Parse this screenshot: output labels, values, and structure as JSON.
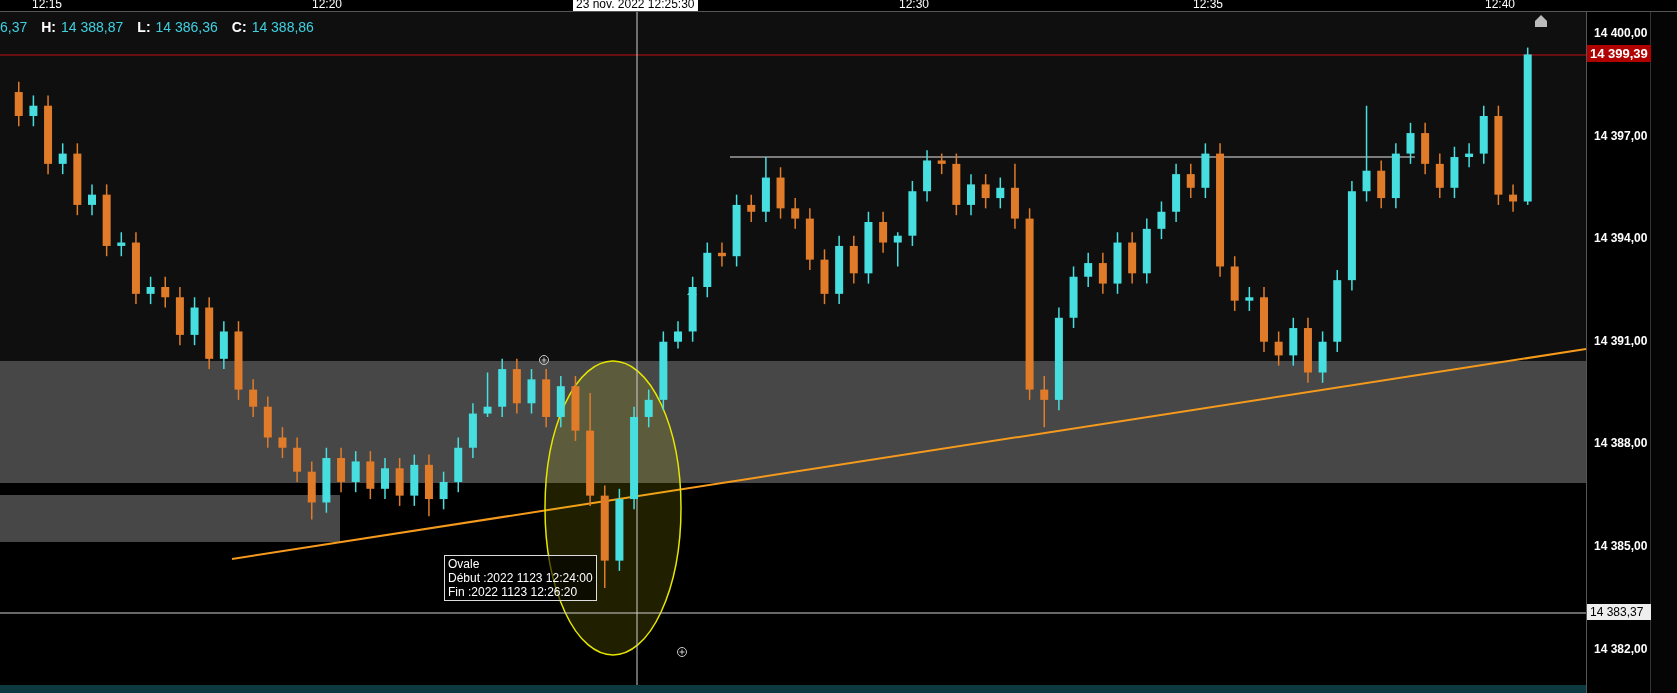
{
  "time_axis": {
    "labels": [
      "12:15",
      "12:20",
      "12:30",
      "12:35",
      "12:40"
    ],
    "crosshair_label": "23 nov. 2022 12:25:30"
  },
  "legend": {
    "partial_value": "6,37",
    "items": [
      {
        "label": "H:",
        "value": "14 388,87"
      },
      {
        "label": "L:",
        "value": "14 386,36"
      },
      {
        "label": "C:",
        "value": "14 388,86"
      }
    ]
  },
  "price_axis": {
    "last_price_label": "14 399,39",
    "crosshair_label": "14 383,37"
  },
  "tooltip": {
    "title": "Ovale",
    "lines": [
      "Début :2022 1123 12:24:00",
      "Fin :2022 1123 12:26:20"
    ]
  },
  "chart_data": {
    "type": "candlestick",
    "ylim": [
      14380.73,
      14400.64
    ],
    "yticks": [
      {
        "value": 14400,
        "label": "14 400,00"
      },
      {
        "value": 14397,
        "label": "14 397,00"
      },
      {
        "value": 14394,
        "label": "14 394,00"
      },
      {
        "value": 14391,
        "label": "14 391,00"
      },
      {
        "value": 14388,
        "label": "14 388,00"
      },
      {
        "value": 14385,
        "label": "14 385,00"
      },
      {
        "value": 14382,
        "label": "14 382,00"
      }
    ],
    "categories": [
      null,
      null,
      null,
      null,
      null,
      null,
      null,
      null,
      null,
      null,
      null,
      null,
      null,
      null,
      null,
      null,
      null,
      null,
      null,
      null,
      null,
      null,
      null,
      null,
      null,
      null,
      null,
      null,
      null,
      null,
      null,
      null,
      null,
      null,
      null,
      null,
      null,
      null,
      null,
      null,
      null,
      null,
      null,
      null,
      null,
      null,
      null,
      null,
      null,
      null,
      null,
      null,
      null,
      null,
      null,
      null,
      null,
      null,
      null,
      null,
      null,
      null,
      null,
      null,
      null,
      null,
      null,
      null,
      null,
      null,
      null,
      null,
      null,
      null,
      null,
      null,
      null,
      null,
      null,
      null,
      null,
      null,
      null,
      null,
      null,
      null,
      null,
      null,
      null,
      null,
      null,
      null,
      null,
      null,
      null,
      null,
      null,
      null,
      null,
      null,
      null,
      null,
      null,
      null
    ],
    "ohlc": [
      [
        14398.3,
        14398.6,
        14397.3,
        14397.6
      ],
      [
        14397.6,
        14398.2,
        14397.3,
        14397.9
      ],
      [
        14397.9,
        14398.2,
        14395.9,
        14396.2
      ],
      [
        14396.2,
        14396.8,
        14395.9,
        14396.5
      ],
      [
        14396.5,
        14396.8,
        14394.7,
        14395.0
      ],
      [
        14395.0,
        14395.6,
        14394.7,
        14395.3
      ],
      [
        14395.3,
        14395.6,
        14393.5,
        14393.8
      ],
      [
        14393.8,
        14394.2,
        14393.5,
        14393.9
      ],
      [
        14393.9,
        14394.2,
        14392.1,
        14392.4
      ],
      [
        14392.4,
        14392.9,
        14392.1,
        14392.6
      ],
      [
        14392.6,
        14392.9,
        14392.0,
        14392.3
      ],
      [
        14392.3,
        14392.6,
        14390.9,
        14391.2
      ],
      [
        14391.2,
        14392.3,
        14390.9,
        14392.0
      ],
      [
        14392.0,
        14392.3,
        14390.2,
        14390.5
      ],
      [
        14390.5,
        14391.6,
        14390.2,
        14391.3
      ],
      [
        14391.3,
        14391.6,
        14389.3,
        14389.6
      ],
      [
        14389.6,
        14389.9,
        14388.8,
        14389.1
      ],
      [
        14389.1,
        14389.4,
        14387.9,
        14388.2
      ],
      [
        14388.2,
        14388.5,
        14387.6,
        14387.9
      ],
      [
        14387.9,
        14388.2,
        14386.9,
        14387.2
      ],
      [
        14387.2,
        14387.5,
        14385.8,
        14386.3
      ],
      [
        14386.3,
        14387.9,
        14386.0,
        14387.6
      ],
      [
        14387.6,
        14387.9,
        14386.6,
        14386.9
      ],
      [
        14386.9,
        14387.8,
        14386.6,
        14387.5
      ],
      [
        14387.5,
        14387.8,
        14386.4,
        14386.7
      ],
      [
        14386.7,
        14387.6,
        14386.4,
        14387.3
      ],
      [
        14387.3,
        14387.6,
        14386.2,
        14386.5
      ],
      [
        14386.5,
        14387.7,
        14386.2,
        14387.4
      ],
      [
        14387.4,
        14387.7,
        14385.9,
        14386.4
      ],
      [
        14386.4,
        14387.2,
        14386.1,
        14386.9
      ],
      [
        14386.9,
        14388.2,
        14386.6,
        14387.9
      ],
      [
        14387.9,
        14389.2,
        14387.6,
        14388.9
      ],
      [
        14388.9,
        14390.1,
        14388.8,
        14389.1
      ],
      [
        14389.1,
        14390.5,
        14388.8,
        14390.2
      ],
      [
        14390.2,
        14390.5,
        14388.9,
        14389.2
      ],
      [
        14389.2,
        14390.2,
        14388.9,
        14389.9
      ],
      [
        14389.9,
        14390.2,
        14388.5,
        14388.8
      ],
      [
        14388.8,
        14390.0,
        14388.5,
        14389.7
      ],
      [
        14389.7,
        14390.0,
        14388.1,
        14388.4
      ],
      [
        14388.4,
        14389.5,
        14386.2,
        14386.5
      ],
      [
        14386.5,
        14386.8,
        14383.8,
        14384.6
      ],
      [
        14384.6,
        14386.7,
        14384.3,
        14386.4
      ],
      [
        14386.4,
        14389.1,
        14386.1,
        14388.8
      ],
      [
        14388.8,
        14389.6,
        14388.5,
        14389.3
      ],
      [
        14389.3,
        14391.3,
        14389.0,
        14391.0
      ],
      [
        14391.0,
        14391.6,
        14390.8,
        14391.3
      ],
      [
        14391.3,
        14392.9,
        14391.0,
        14392.6
      ],
      [
        14392.6,
        14393.9,
        14392.3,
        14393.6
      ],
      [
        14393.6,
        14393.9,
        14393.2,
        14393.5
      ],
      [
        14393.5,
        14395.3,
        14393.2,
        14395.0
      ],
      [
        14395.0,
        14395.3,
        14394.5,
        14394.8
      ],
      [
        14394.8,
        14396.4,
        14394.5,
        14395.8
      ],
      [
        14395.8,
        14396.1,
        14394.6,
        14394.9
      ],
      [
        14394.9,
        14395.2,
        14394.3,
        14394.6
      ],
      [
        14394.6,
        14394.9,
        14393.1,
        14393.4
      ],
      [
        14393.4,
        14393.7,
        14392.1,
        14392.4
      ],
      [
        14392.4,
        14394.1,
        14392.1,
        14393.8
      ],
      [
        14393.8,
        14394.1,
        14392.7,
        14393.0
      ],
      [
        14393.0,
        14394.8,
        14392.7,
        14394.5
      ],
      [
        14394.5,
        14394.8,
        14393.6,
        14393.9
      ],
      [
        14393.9,
        14394.2,
        14393.2,
        14394.1
      ],
      [
        14394.1,
        14395.7,
        14393.8,
        14395.4
      ],
      [
        14395.4,
        14396.6,
        14395.1,
        14396.3
      ],
      [
        14396.3,
        14396.5,
        14395.9,
        14396.2
      ],
      [
        14396.2,
        14396.5,
        14394.7,
        14395.0
      ],
      [
        14395.0,
        14395.9,
        14394.7,
        14395.6
      ],
      [
        14395.6,
        14395.9,
        14394.9,
        14395.2
      ],
      [
        14395.2,
        14395.8,
        14394.9,
        14395.5
      ],
      [
        14395.5,
        14396.2,
        14394.3,
        14394.6
      ],
      [
        14394.6,
        14394.9,
        14389.3,
        14389.6
      ],
      [
        14389.6,
        14390.0,
        14388.5,
        14389.3
      ],
      [
        14389.3,
        14392.0,
        14389.0,
        14391.7
      ],
      [
        14391.7,
        14393.2,
        14391.4,
        14392.9
      ],
      [
        14392.9,
        14393.6,
        14392.6,
        14393.3
      ],
      [
        14393.3,
        14393.6,
        14392.4,
        14392.7
      ],
      [
        14392.7,
        14394.2,
        14392.4,
        14393.9
      ],
      [
        14393.9,
        14394.2,
        14392.7,
        14393.0
      ],
      [
        14393.0,
        14394.6,
        14392.7,
        14394.3
      ],
      [
        14394.3,
        14395.1,
        14394.0,
        14394.8
      ],
      [
        14394.8,
        14396.2,
        14394.5,
        14395.9
      ],
      [
        14395.9,
        14396.2,
        14395.2,
        14395.5
      ],
      [
        14395.5,
        14396.8,
        14395.2,
        14396.5
      ],
      [
        14396.5,
        14396.8,
        14392.9,
        14393.2
      ],
      [
        14393.2,
        14393.5,
        14391.9,
        14392.2
      ],
      [
        14392.2,
        14392.6,
        14391.9,
        14392.3
      ],
      [
        14392.3,
        14392.6,
        14390.7,
        14391.0
      ],
      [
        14391.0,
        14391.3,
        14390.3,
        14390.6
      ],
      [
        14390.6,
        14391.7,
        14390.3,
        14391.4
      ],
      [
        14391.4,
        14391.7,
        14389.8,
        14390.1
      ],
      [
        14390.1,
        14391.3,
        14389.8,
        14391.0
      ],
      [
        14391.0,
        14393.1,
        14390.7,
        14392.8
      ],
      [
        14392.8,
        14395.7,
        14392.5,
        14395.4
      ],
      [
        14395.4,
        14397.9,
        14395.1,
        14396.0
      ],
      [
        14396.0,
        14396.3,
        14394.9,
        14395.2
      ],
      [
        14395.2,
        14396.8,
        14394.9,
        14396.5
      ],
      [
        14396.5,
        14397.4,
        14396.2,
        14397.1
      ],
      [
        14397.1,
        14397.4,
        14395.9,
        14396.2
      ],
      [
        14396.2,
        14396.5,
        14395.2,
        14395.5
      ],
      [
        14395.5,
        14396.7,
        14395.2,
        14396.4
      ],
      [
        14396.4,
        14396.8,
        14396.1,
        14396.5
      ],
      [
        14396.5,
        14397.9,
        14396.2,
        14397.6
      ],
      [
        14397.6,
        14397.9,
        14395.0,
        14395.3
      ],
      [
        14395.3,
        14395.6,
        14394.8,
        14395.1
      ],
      [
        14395.1,
        14399.6,
        14395.0,
        14399.4
      ]
    ]
  }
}
